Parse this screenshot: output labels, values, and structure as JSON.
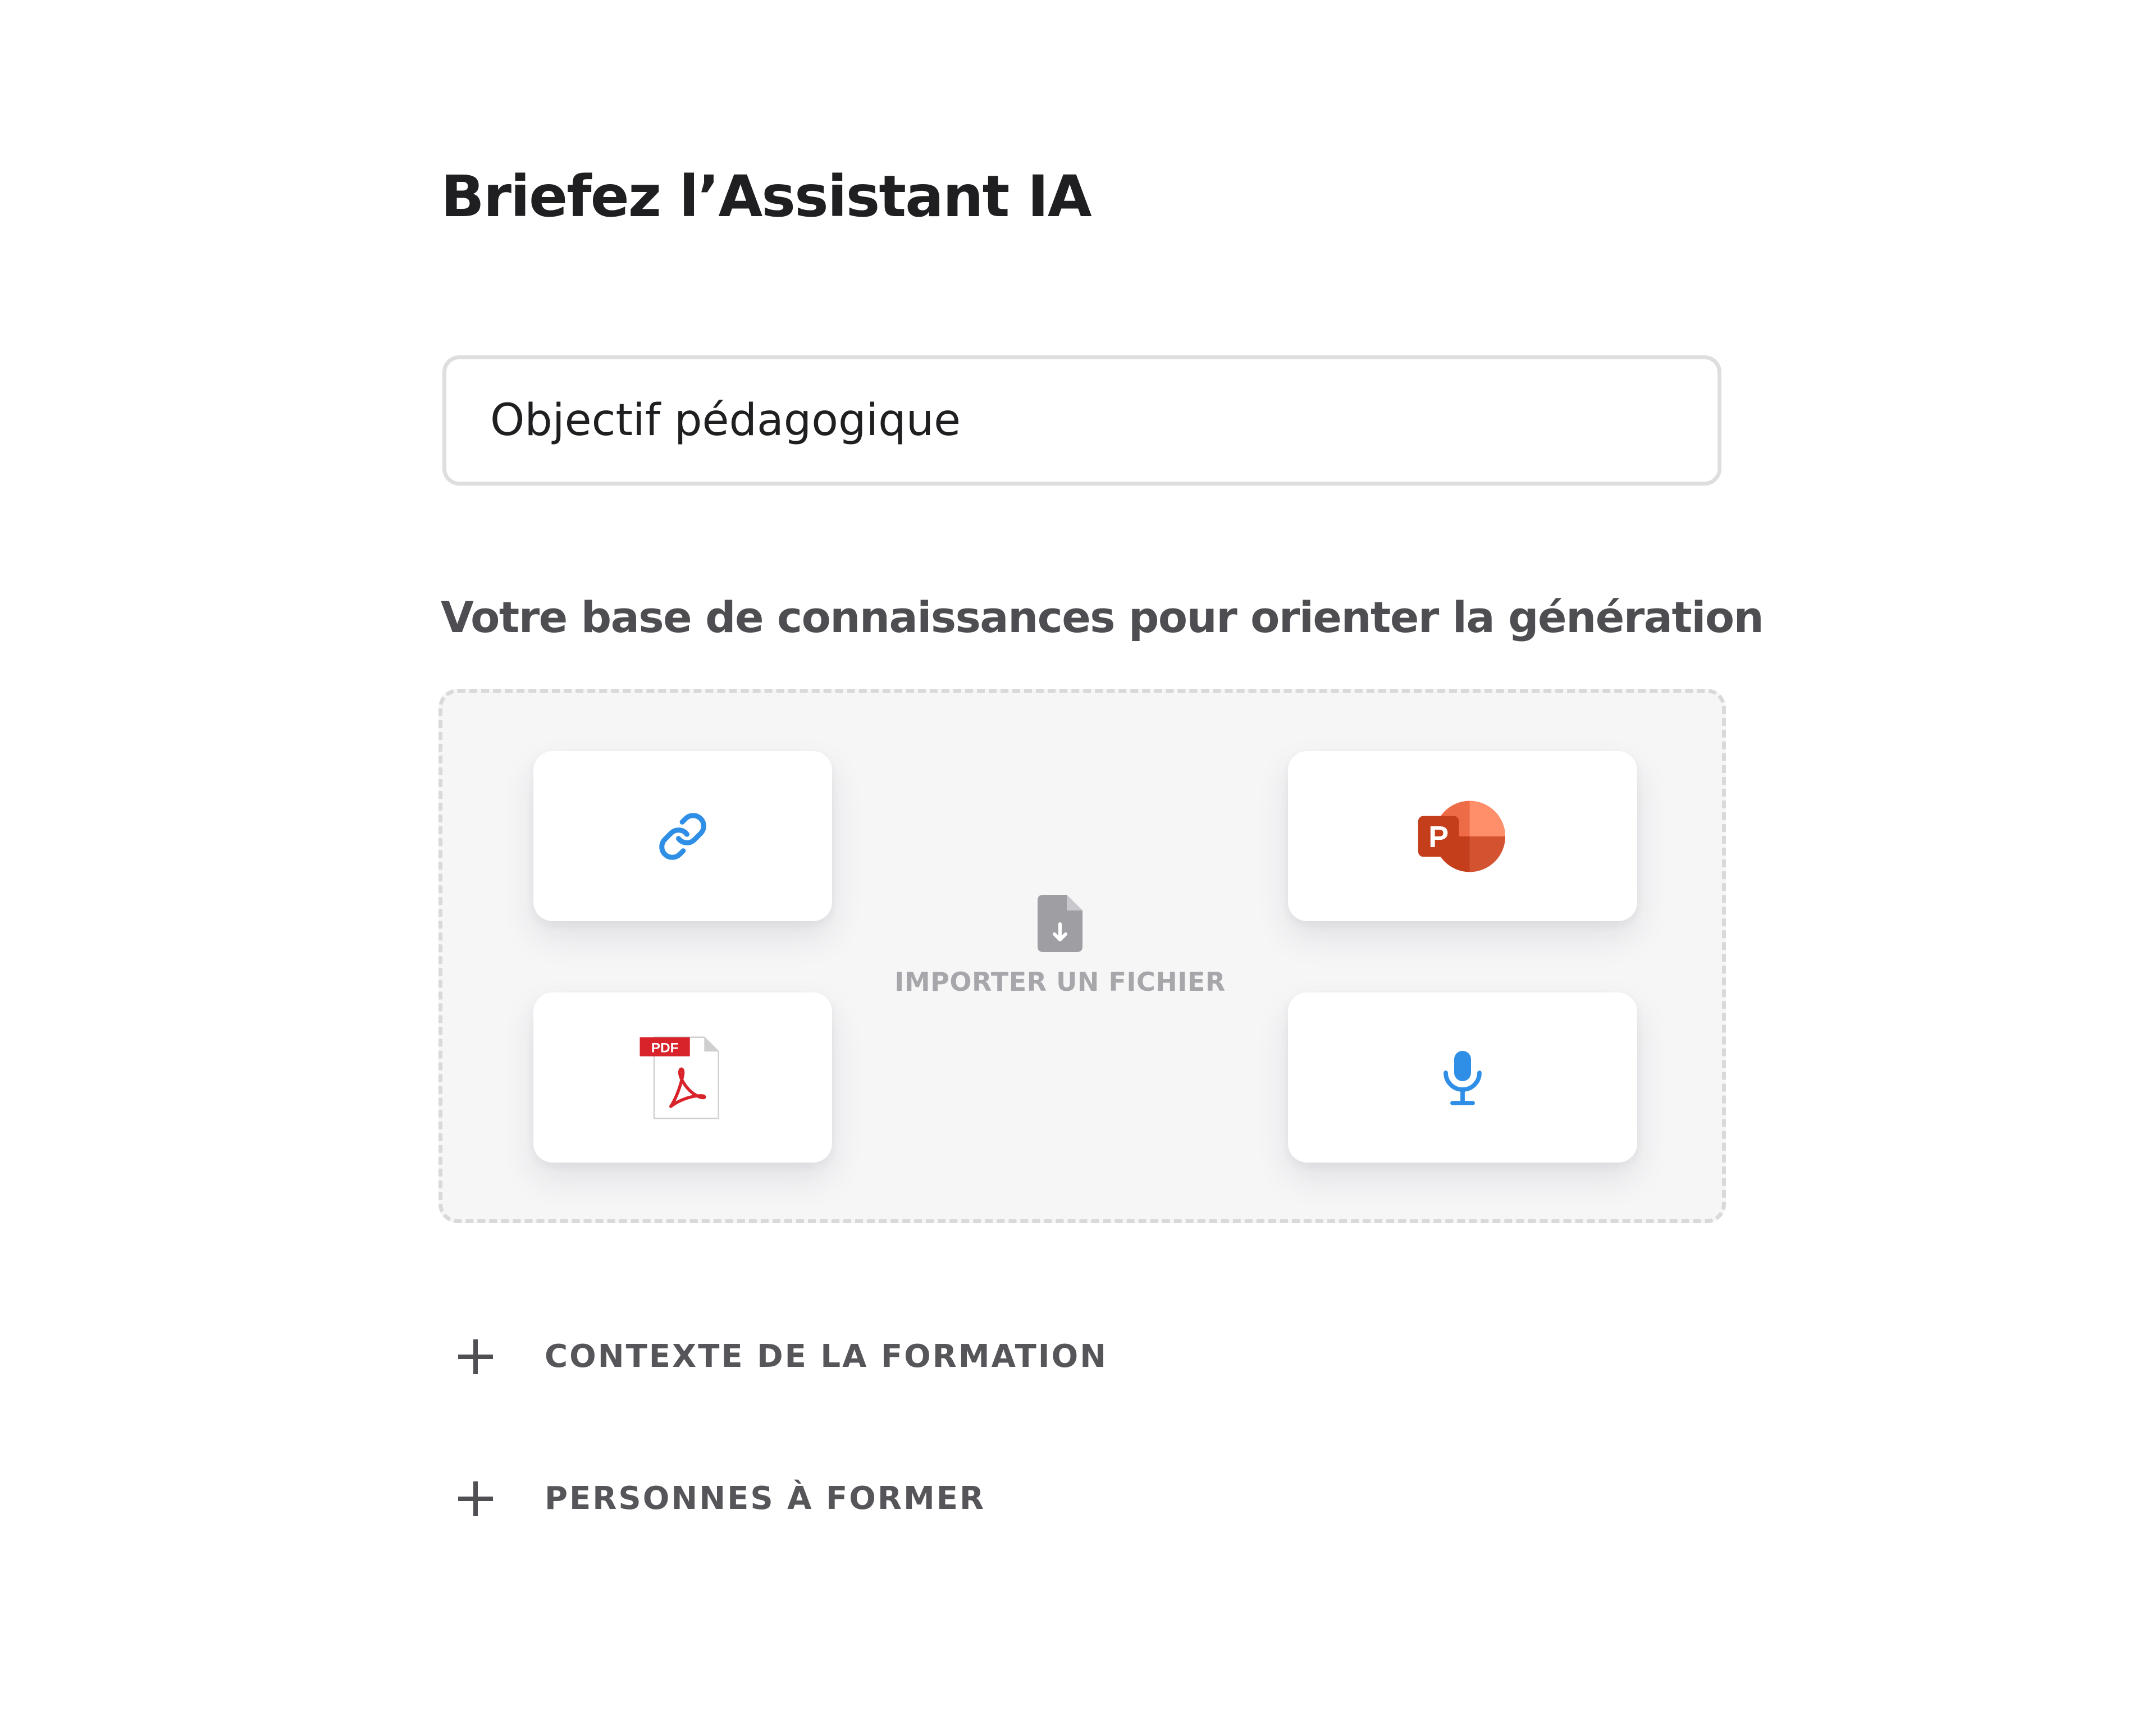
{
  "header": {
    "title": "Briefez l’Assistant IA"
  },
  "objective": {
    "placeholder": "Objectif pédagogique",
    "value": ""
  },
  "knowledge_base": {
    "label": "Votre base de connaissances pour orienter la génération",
    "import_label": "IMPORTER UN FICHIER",
    "sources": [
      {
        "icon": "link-icon",
        "type": "link"
      },
      {
        "icon": "pdf-icon",
        "type": "pdf",
        "badge": "PDF"
      },
      {
        "icon": "powerpoint-icon",
        "type": "powerpoint",
        "letter": "P"
      },
      {
        "icon": "microphone-icon",
        "type": "audio"
      }
    ]
  },
  "sections": [
    {
      "icon": "plus-icon",
      "label": "CONTEXTE DE LA FORMATION"
    },
    {
      "icon": "plus-icon",
      "label": "PERSONNES À FORMER"
    }
  ],
  "colors": {
    "accent_blue": "#2f8fe6",
    "pdf_red": "#d8232a",
    "powerpoint_orange": "#d35230",
    "text_dark": "#1f1f22",
    "text_muted": "#a7a7ab"
  }
}
